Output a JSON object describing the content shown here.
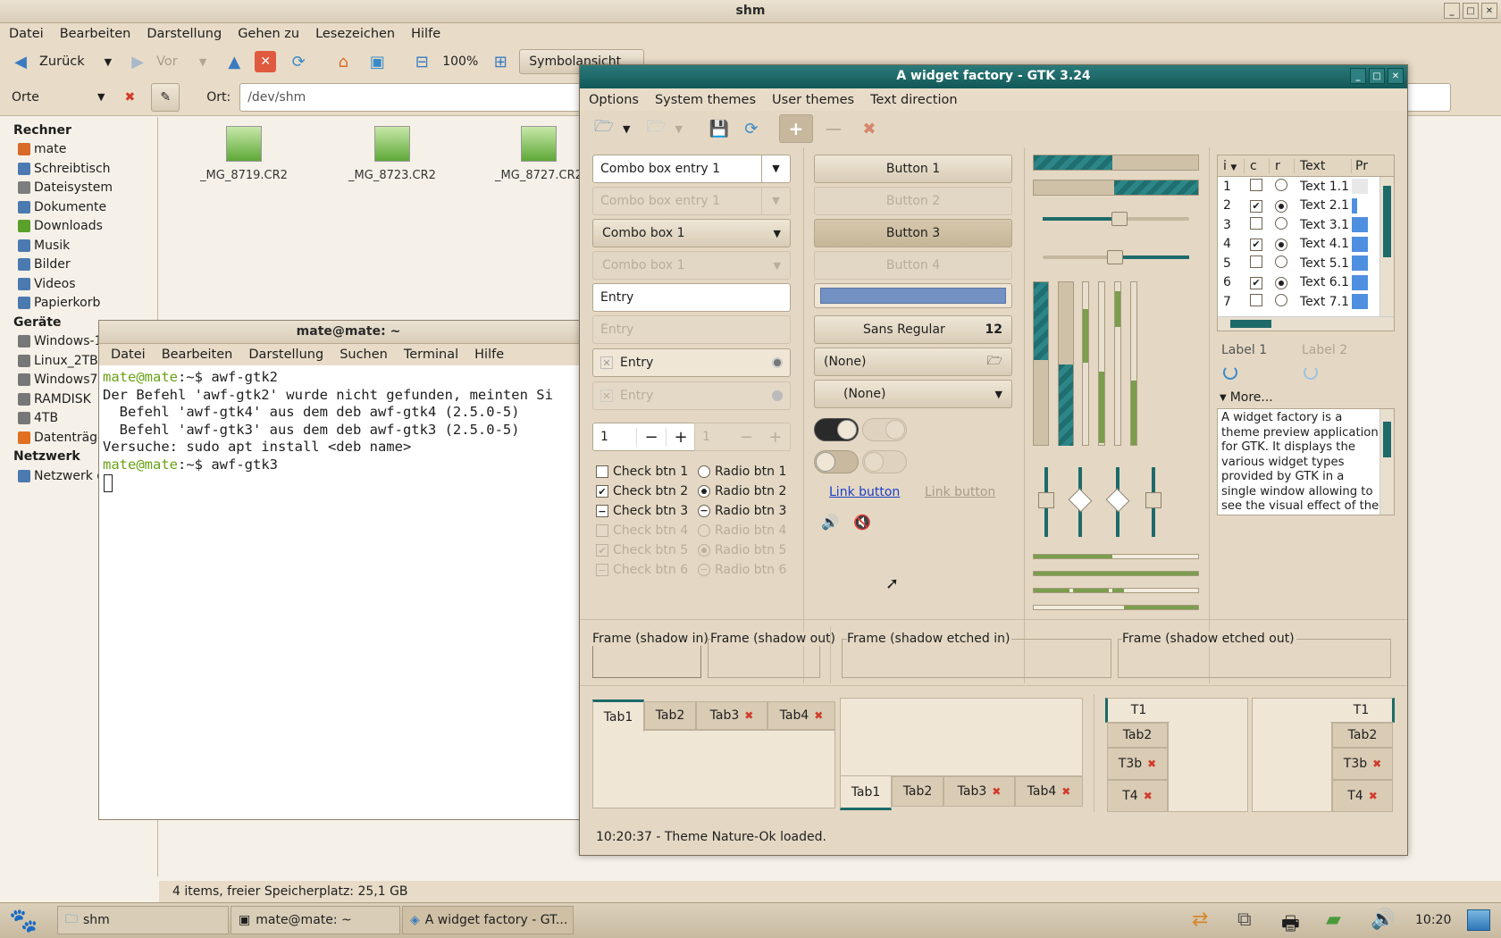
{
  "fm": {
    "title": "shm",
    "menu": [
      "Datei",
      "Bearbeiten",
      "Darstellung",
      "Gehen zu",
      "Lesezeichen",
      "Hilfe"
    ],
    "back": "Zurück",
    "forward": "Vor",
    "zoom": "100%",
    "view": "Symbolansicht",
    "places_label": "Orte",
    "location_label": "Ort:",
    "location": "/dev/shm",
    "sidebar": [
      {
        "h": "Rechner"
      },
      {
        "t": "mate",
        "c": "#d86a2a"
      },
      {
        "t": "Schreibtisch",
        "c": "#4a7ab0"
      },
      {
        "t": "Dateisystem",
        "c": "#7d7d7d"
      },
      {
        "t": "Dokumente",
        "c": "#4a7ab0"
      },
      {
        "t": "Downloads",
        "c": "#5aa02c"
      },
      {
        "t": "Musik",
        "c": "#4a7ab0"
      },
      {
        "t": "Bilder",
        "c": "#4a7ab0"
      },
      {
        "t": "Videos",
        "c": "#4a7ab0"
      },
      {
        "t": "Papierkorb",
        "c": "#4a7ab0"
      },
      {
        "h": "Geräte"
      },
      {
        "t": "Windows-1",
        "c": "#777"
      },
      {
        "t": "Linux_2TB",
        "c": "#777"
      },
      {
        "t": "Windows7",
        "c": "#777"
      },
      {
        "t": "RAMDISK",
        "c": "#777"
      },
      {
        "t": "4TB",
        "c": "#777"
      },
      {
        "t": "Datenträger",
        "c": "#e07020"
      },
      {
        "h": "Netzwerk"
      },
      {
        "t": "Netzwerk d",
        "c": "#4a7ab0"
      }
    ],
    "files": [
      "_MG_8719.CR2",
      "_MG_8723.CR2",
      "_MG_8727.CR2"
    ],
    "status": "4 items, freier Speicherplatz: 25,1 GB"
  },
  "term": {
    "title": "mate@mate: ~",
    "menu": [
      "Datei",
      "Bearbeiten",
      "Darstellung",
      "Suchen",
      "Terminal",
      "Hilfe"
    ],
    "prompt": "mate@mate",
    "path": ":~$ ",
    "cmd1": "awf-gtk2",
    "l2": "Der Befehl 'awf-gtk2' wurde nicht gefunden, meinten Si",
    "l3": "  Befehl 'awf-gtk4' aus dem deb awf-gtk4 (2.5.0-5)",
    "l4": "  Befehl 'awf-gtk3' aus dem deb awf-gtk3 (2.5.0-5)",
    "l5": "Versuche: sudo apt install <deb name>",
    "cmd2": "awf-gtk3"
  },
  "awf": {
    "title": "A widget factory - GTK 3.24",
    "menu": [
      "Options",
      "System themes",
      "User themes",
      "Text direction"
    ],
    "combo_entry": "Combo box entry 1",
    "combo": "Combo box 1",
    "entry": "Entry",
    "spin": "1",
    "checks": [
      "Check btn 1",
      "Check btn 2",
      "Check btn 3",
      "Check btn 4",
      "Check btn 5",
      "Check btn 6"
    ],
    "radios": [
      "Radio btn 1",
      "Radio btn 2",
      "Radio btn 3",
      "Radio btn 4",
      "Radio btn 5",
      "Radio btn 6"
    ],
    "buttons": [
      "Button 1",
      "Button 2",
      "Button 3",
      "Button 4"
    ],
    "font": "Sans Regular",
    "font_size": "12",
    "file_none": "(None)",
    "combo_none": "(None)",
    "link": "Link button",
    "tree_head": [
      "i",
      "c",
      "r",
      "Text",
      "Pr"
    ],
    "tree": [
      {
        "i": "1",
        "c": false,
        "r": false,
        "t": "Text 1.1"
      },
      {
        "i": "2",
        "c": true,
        "r": true,
        "t": "Text 2.1"
      },
      {
        "i": "3",
        "c": false,
        "r": false,
        "t": "Text 3.1"
      },
      {
        "i": "4",
        "c": true,
        "r": true,
        "t": "Text 4.1"
      },
      {
        "i": "5",
        "c": false,
        "r": false,
        "t": "Text 5.1"
      },
      {
        "i": "6",
        "c": true,
        "r": true,
        "t": "Text 6.1"
      },
      {
        "i": "7",
        "c": false,
        "r": false,
        "t": "Text 7.1"
      }
    ],
    "label1": "Label 1",
    "label2": "Label 2",
    "more": "More...",
    "textview": "A widget factory is a theme preview application for GTK. It displays the various widget types provided by GTK in a single window allowing to see the visual effect of the applied",
    "frames": [
      "Frame (shadow in)",
      "Frame (shadow out)",
      "Frame (shadow etched in)",
      "Frame (shadow etched out)"
    ],
    "tabs": [
      "Tab1",
      "Tab2",
      "Tab3",
      "Tab4"
    ],
    "vtabs": [
      "T1",
      "Tab2",
      "T3b",
      "T4"
    ],
    "status": "10:20:37 - Theme Nature-Ok loaded."
  },
  "panel": {
    "tasks": [
      "shm",
      "mate@mate: ~",
      "A widget factory - GT..."
    ],
    "clock": "10:20"
  }
}
